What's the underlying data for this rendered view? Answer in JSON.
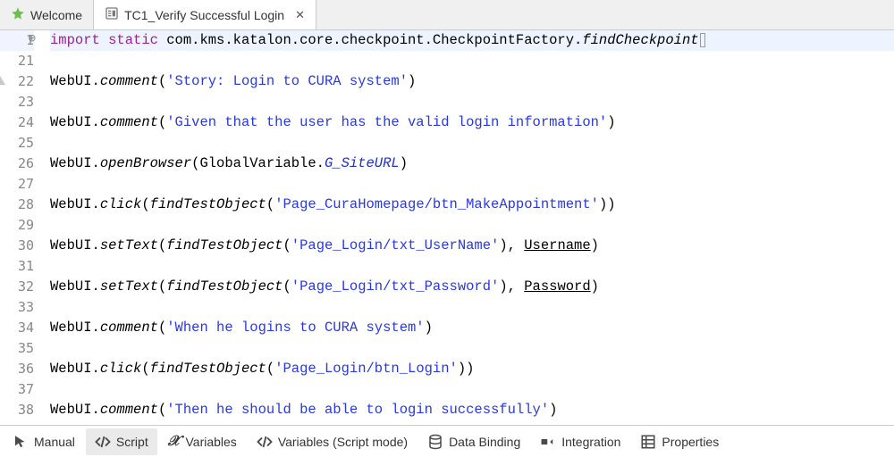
{
  "tabs": {
    "welcome": "Welcome",
    "file": "TC1_Verify Successful Login"
  },
  "code": {
    "line1": {
      "kw1": "import",
      "kw2": "static",
      "rest": "com.kms.katalon.core.checkpoint.CheckpointFactory.",
      "tail": "findCheckpoint"
    },
    "lines": [
      {
        "n": 21,
        "raw": ""
      },
      {
        "n": 22,
        "segs": [
          "WebUI.",
          "comment",
          "(",
          "'Story: Login to CURA system'",
          ")"
        ]
      },
      {
        "n": 23,
        "raw": ""
      },
      {
        "n": 24,
        "segs": [
          "WebUI.",
          "comment",
          "(",
          "'Given that the user has the valid login information'",
          ")"
        ]
      },
      {
        "n": 25,
        "raw": ""
      },
      {
        "n": 26,
        "segs": [
          "WebUI.",
          "openBrowser",
          "(GlobalVariable.",
          "G_SiteURL",
          ")"
        ],
        "gv": true
      },
      {
        "n": 27,
        "raw": ""
      },
      {
        "n": 28,
        "segs": [
          "WebUI.",
          "click",
          "(",
          "findTestObject",
          "(",
          "'Page_CuraHomepage/btn_MakeAppointment'",
          "))"
        ]
      },
      {
        "n": 29,
        "raw": ""
      },
      {
        "n": 30,
        "segs": [
          "WebUI.",
          "setText",
          "(",
          "findTestObject",
          "(",
          "'Page_Login/txt_UserName'",
          "), ",
          "Username",
          ")"
        ],
        "uvar": true
      },
      {
        "n": 31,
        "raw": ""
      },
      {
        "n": 32,
        "segs": [
          "WebUI.",
          "setText",
          "(",
          "findTestObject",
          "(",
          "'Page_Login/txt_Password'",
          "), ",
          "Password",
          ")"
        ],
        "uvar": true
      },
      {
        "n": 33,
        "raw": ""
      },
      {
        "n": 34,
        "segs": [
          "WebUI.",
          "comment",
          "(",
          "'When he logins to CURA system'",
          ")"
        ]
      },
      {
        "n": 35,
        "raw": ""
      },
      {
        "n": 36,
        "segs": [
          "WebUI.",
          "click",
          "(",
          "findTestObject",
          "(",
          "'Page_Login/btn_Login'",
          "))"
        ]
      },
      {
        "n": 37,
        "raw": ""
      },
      {
        "n": 38,
        "segs": [
          "WebUI.",
          "comment",
          "(",
          "'Then he should be able to login successfully'",
          ")"
        ]
      }
    ]
  },
  "bottomTabs": {
    "manual": "Manual",
    "script": "Script",
    "variables": "Variables",
    "variablesScript": "Variables (Script mode)",
    "dataBinding": "Data Binding",
    "integration": "Integration",
    "properties": "Properties"
  }
}
